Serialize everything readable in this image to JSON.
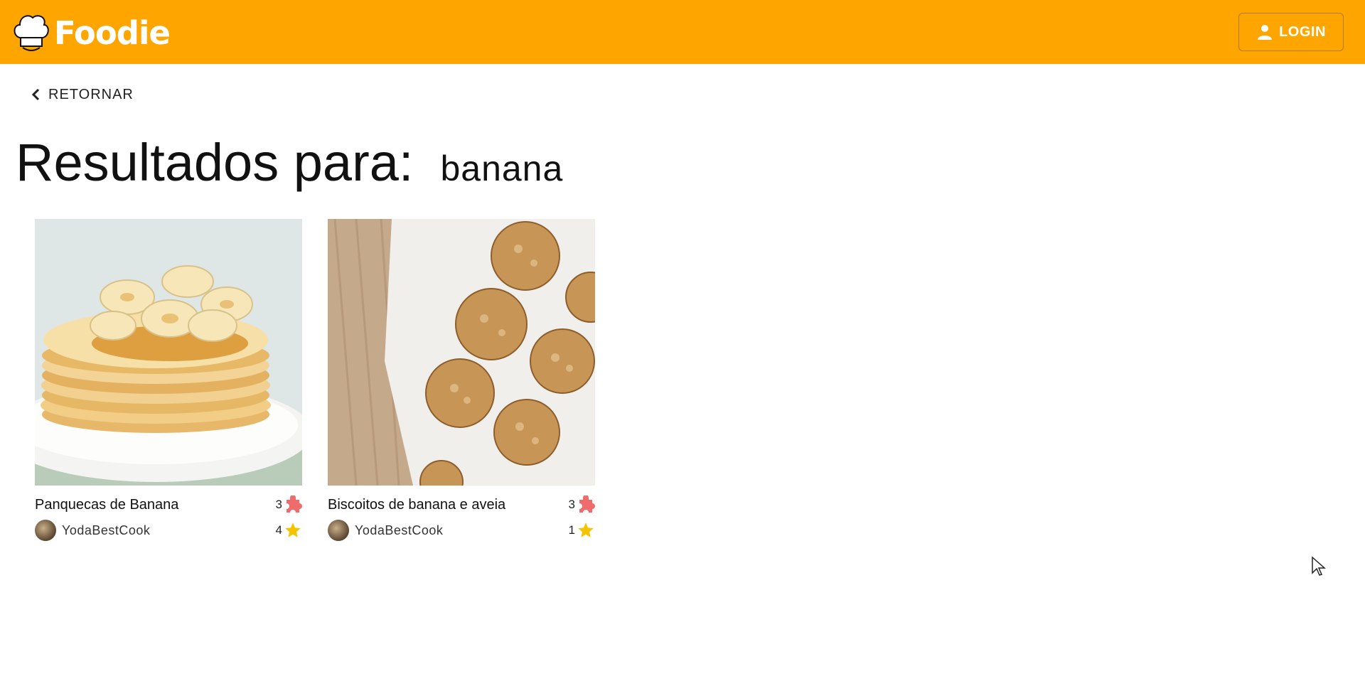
{
  "header": {
    "logo_text": "Foodie",
    "login_label": "LOGIN",
    "brand_color": "#ffa500"
  },
  "nav": {
    "back_label": "RETORNAR"
  },
  "search": {
    "results_label": "Resultados para:",
    "query": "banana"
  },
  "recipes": [
    {
      "title": "Panquecas de Banana",
      "author": "YodaBestCook",
      "pieces_count": "3",
      "stars_count": "4",
      "image_subject": "stack of banana pancakes with syrup"
    },
    {
      "title": "Biscoitos de banana e aveia",
      "author": "YodaBestCook",
      "pieces_count": "3",
      "stars_count": "1",
      "image_subject": "oat cookies on baking paper"
    }
  ],
  "icons": {
    "piece_color": "#f06b6b",
    "star_color": "#f5c400"
  }
}
